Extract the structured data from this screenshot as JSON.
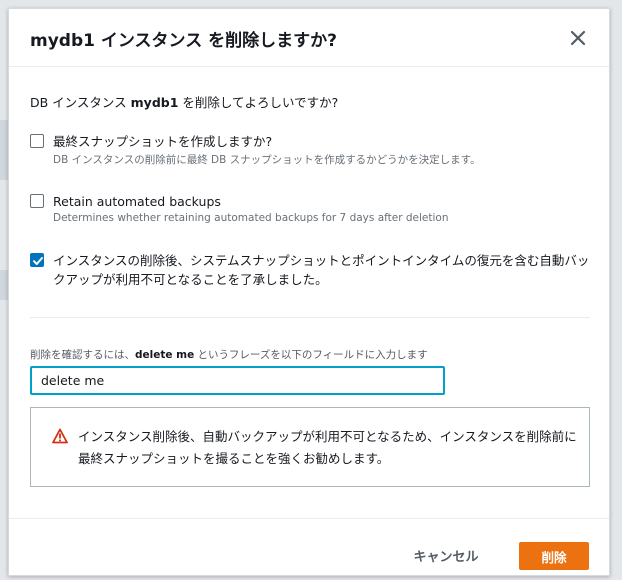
{
  "modal": {
    "title": "mydb1 インスタンス を削除しますか?",
    "close_icon": "close-icon"
  },
  "question": {
    "prefix": "DB インスタンス ",
    "name": "mydb1",
    "suffix": " を削除してよろしいですか?"
  },
  "options": [
    {
      "label": "最終スナップショットを作成しますか?",
      "description": "DB インスタンスの削除前に最終 DB スナップショットを作成するかどうかを決定します。",
      "checked": false
    },
    {
      "label": "Retain automated backups",
      "description": "Determines whether retaining automated backups for 7 days after deletion",
      "checked": false
    },
    {
      "label": "インスタンスの削除後、システムスナップショットとポイントインタイムの復元を含む自動バックアップが利用不可となることを了承しました。",
      "description": "",
      "checked": true
    }
  ],
  "confirm": {
    "label_prefix": "削除を確認するには、",
    "label_phrase": "delete me",
    "label_suffix": " というフレーズを以下のフィールドに入力します",
    "value": "delete me"
  },
  "alert": {
    "icon": "warning-icon",
    "text": "インスタンス削除後、自動バックアップが利用不可となるため、インスタンスを削除前に最終スナップショットを撮ることを強くお勧めします。",
    "color": "#d13212"
  },
  "footer": {
    "cancel_label": "キャンセル",
    "delete_label": "削除",
    "accent": "#ec7211"
  }
}
